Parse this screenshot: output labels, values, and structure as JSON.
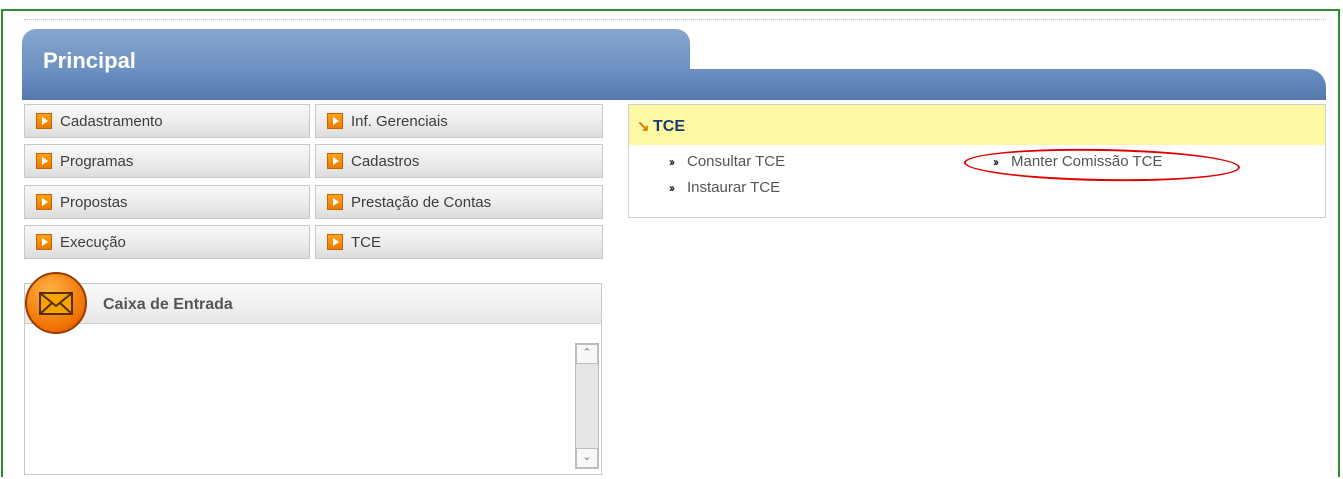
{
  "header": {
    "title": "Principal"
  },
  "menu": {
    "left": [
      "Cadastramento",
      "Programas",
      "Propostas",
      "Execução"
    ],
    "right": [
      "Inf. Gerenciais",
      "Cadastros",
      "Prestação de Contas",
      "TCE"
    ]
  },
  "inbox": {
    "title": "Caixa de Entrada"
  },
  "tce_panel": {
    "title": "TCE",
    "links": [
      "Consultar TCE",
      "Instaurar TCE",
      "Manter Comissão TCE"
    ]
  },
  "scrollbar": {
    "up": "⌃",
    "down": "⌄"
  },
  "colors": {
    "accent": "#6b8fc0",
    "highlight": "#fcf8a3",
    "orange": "#f07000"
  }
}
